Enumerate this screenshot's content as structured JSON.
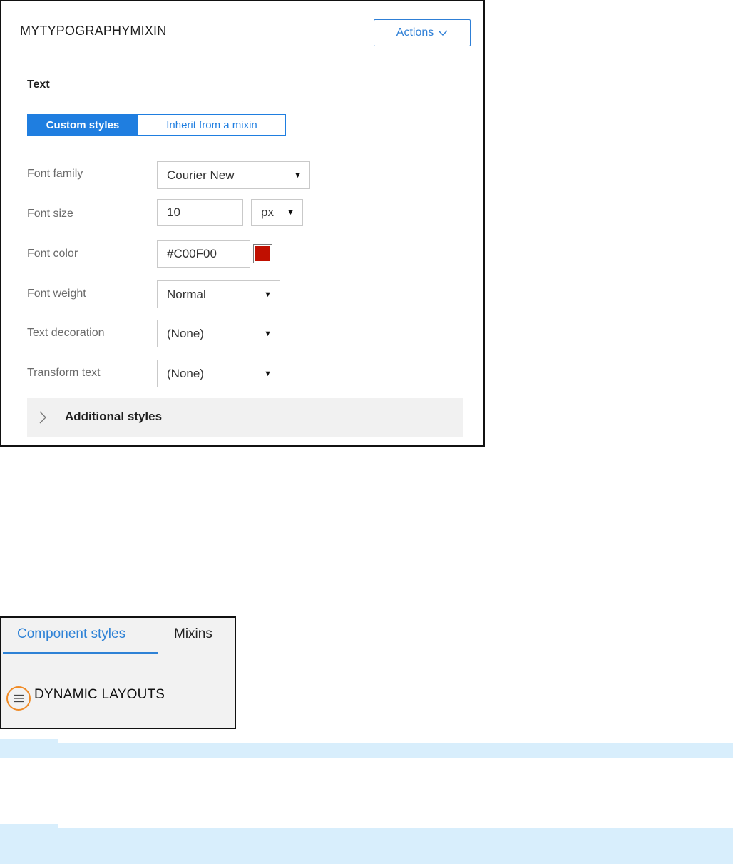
{
  "panel1": {
    "title": "MYTYPOGRAPHYMIXIN",
    "actions_label": "Actions",
    "section_title": "Text",
    "toggle": {
      "active": "Custom styles",
      "inactive": "Inherit from a mixin"
    },
    "fields": {
      "font_family": {
        "label": "Font family",
        "value": "Courier New"
      },
      "font_size": {
        "label": "Font size",
        "value": "10",
        "unit": "px"
      },
      "font_color": {
        "label": "Font color",
        "value": "#C00F00",
        "swatch": "#c00f00"
      },
      "font_weight": {
        "label": "Font weight",
        "value": "Normal"
      },
      "text_decoration": {
        "label": "Text decoration",
        "value": "(None)"
      },
      "transform_text": {
        "label": "Transform text",
        "value": "(None)"
      }
    },
    "additional_styles": "Additional styles"
  },
  "panel2": {
    "tabs": {
      "component_styles": "Component styles",
      "mixins": "Mixins"
    },
    "section": "DYNAMIC LAYOUTS"
  },
  "colors": {
    "accent": "#1f7ee0",
    "highlight": "#f08a24",
    "callout": "#d8eefc"
  },
  "icons": {
    "actions": "chevron-down-icon",
    "additional": "chevron-right-icon",
    "handle": "hamburger-icon",
    "select": "caret-down-icon"
  }
}
